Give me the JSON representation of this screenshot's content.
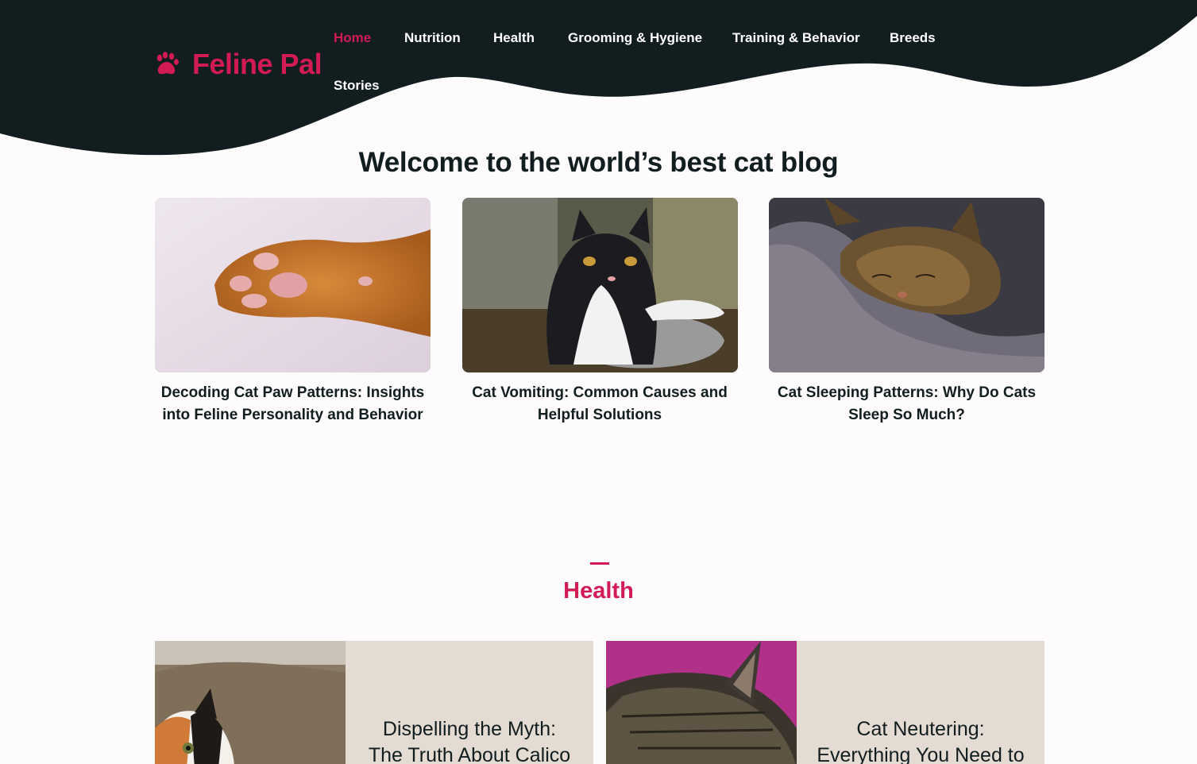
{
  "site": {
    "logo_text": "Feline Pal"
  },
  "nav": {
    "items": [
      {
        "label": "Home",
        "active": true
      },
      {
        "label": "Nutrition",
        "active": false
      },
      {
        "label": "Health",
        "active": false
      },
      {
        "label": "Grooming & Hygiene",
        "active": false
      },
      {
        "label": "Training & Behavior",
        "active": false
      },
      {
        "label": "Breeds",
        "active": false
      },
      {
        "label": "Stories",
        "active": false
      }
    ]
  },
  "hero": {
    "heading": "Welcome to the world’s best cat blog"
  },
  "featured": [
    {
      "title": "Decoding Cat Paw Patterns: Insights into Feline Personality and Behavior",
      "image": "orange-cat-paw-photo"
    },
    {
      "title": "Cat Vomiting: Common Causes and Helpful Solutions",
      "image": "black-white-cat-photo"
    },
    {
      "title": "Cat Sleeping Patterns: Why Do Cats Sleep So Much?",
      "image": "sleeping-tabby-photo"
    }
  ],
  "health_section": {
    "title": "Health",
    "posts": [
      {
        "title_line1": "Dispelling the Myth:",
        "title_line2": "The Truth About Calico",
        "image": "calico-cat-photo"
      },
      {
        "title_line1": "Cat Neutering:",
        "title_line2": "Everything You Need to",
        "image": "tabby-cat-photo"
      }
    ]
  },
  "colors": {
    "accent": "#d21a55",
    "dark": "#111d1f",
    "card_bg": "#e4dbd2",
    "page_bg": "#fdfbfc"
  }
}
